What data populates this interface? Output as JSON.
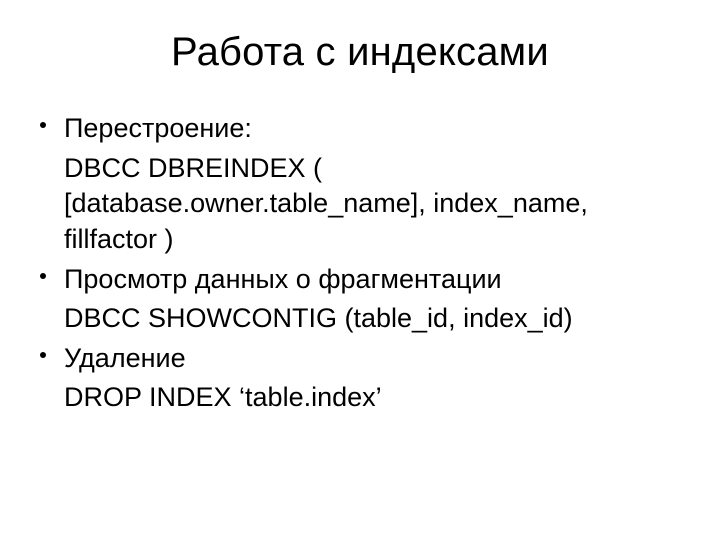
{
  "title": "Работа с индексами",
  "lines": [
    {
      "bullet": true,
      "text": "Перестроение:"
    },
    {
      "bullet": false,
      "text": "DBCC DBREINDEX ( [database.owner.table_name], index_name, fillfactor )"
    },
    {
      "bullet": true,
      "text": "Просмотр данных о фрагментации"
    },
    {
      "bullet": false,
      "text": "DBCC SHOWCONTIG (table_id, index_id)"
    },
    {
      "bullet": true,
      "text": "Удаление"
    },
    {
      "bullet": false,
      "text": "DROP INDEX ‘table.index’"
    }
  ]
}
